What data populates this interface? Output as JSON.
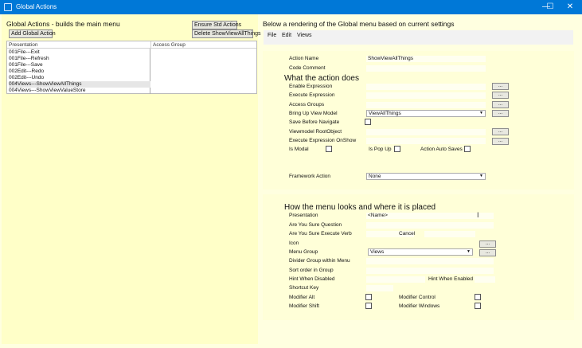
{
  "window": {
    "title": "Global Actions",
    "min": "—",
    "max": "☐",
    "close": "✕"
  },
  "left": {
    "title": "Global Actions - builds the main menu",
    "add_label": "Add Global Action",
    "ensure_label": "Ensure Std Actions",
    "delete_label": "Delete ShowViewAllThings",
    "col_presentation": "Presentation",
    "col_access": "Access Group",
    "rows": [
      "001File---Exit",
      "001File---Refresh",
      "001File---Save",
      "002Edit---Redo",
      "002Edit---Undo",
      "004Views---ShowViewAllThings",
      "004Views---ShowViewValueStore"
    ]
  },
  "right": {
    "title": "Below a rendering of the Global menu based on current settings",
    "menu": [
      "File",
      "Edit",
      "Views"
    ],
    "action": {
      "name_label": "Action Name",
      "name_value": "ShowViewAllThings",
      "comment_label": "Code Comment",
      "section": "What the action does",
      "enable_label": "Enable Expression",
      "execute_label": "Execute Expression",
      "access_label": "Access Groups",
      "viewmodel_label": "Bring Up View Model",
      "viewmodel_value": "ViewAllThings",
      "save_label": "Save Before Navigate",
      "root_label": "Viewmodel RootObject",
      "onshow_label": "Execute Expression OnShow",
      "modal_label": "Is Modal",
      "popup_label": "Is Pop Up",
      "autosave_label": "Action Auto Saves",
      "framework_label": "Framework Action",
      "framework_value": "None",
      "ellipsis": "..."
    },
    "menu_look": {
      "section": "How the menu looks and where it is placed",
      "presentation_label": "Presentation",
      "presentation_value": "<Name>",
      "sure_q_label": "Are You Sure Question",
      "sure_verb_label": "Are You Sure Execute Verb",
      "cancel": "Cancel",
      "icon_label": "Icon",
      "group_label": "Menu Group",
      "group_value": "Views",
      "divider_label": "Divider Group within Menu",
      "sort_label": "Sort order in Group",
      "hint_disabled_label": "Hint When Disabled",
      "hint_enabled_label": "Hint When Enabled",
      "shortcut_label": "Shortcut Key",
      "alt_label": "Modifier Alt",
      "control_label": "Modifier Control",
      "shift_label": "Modifier Shift",
      "windows_label": "Modifier Windows"
    }
  }
}
